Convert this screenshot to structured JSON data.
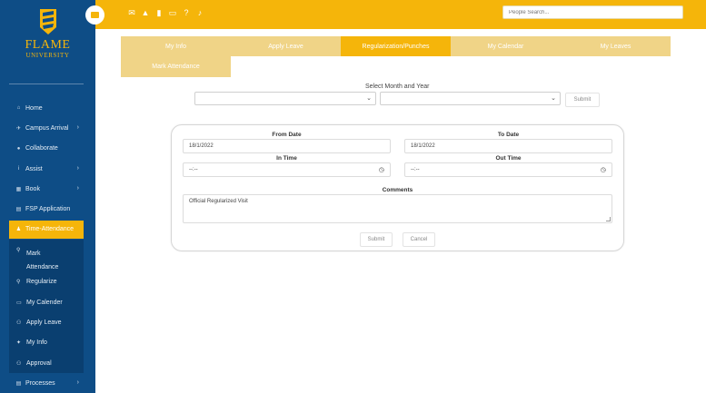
{
  "logo": {
    "line1": "FLAME",
    "line2": "UNIVERSITY"
  },
  "sidebar": {
    "items": [
      {
        "label": "Home",
        "icon": "home-icon",
        "glyph": "⌂",
        "arrow": ""
      },
      {
        "label": "Campus Arrival",
        "icon": "plane-icon",
        "glyph": "✈",
        "arrow": "›"
      },
      {
        "label": "Collaborate",
        "icon": "chat-icon",
        "glyph": "●",
        "arrow": ""
      },
      {
        "label": "Assist",
        "icon": "info-icon",
        "glyph": "i",
        "arrow": "›"
      },
      {
        "label": "Book",
        "icon": "calendar-icon",
        "glyph": "▦",
        "arrow": "›"
      },
      {
        "label": "FSP Application",
        "icon": "document-icon",
        "glyph": "▤",
        "arrow": ""
      },
      {
        "label": "Time-Attendance",
        "icon": "user-icon",
        "glyph": "♟",
        "arrow": ""
      }
    ],
    "submenu": [
      {
        "label": "Mark Attendance",
        "line1": "Mark",
        "line2": "Attendance",
        "icon": "search-icon",
        "glyph": "⚲"
      },
      {
        "label": "Regularize",
        "icon": "search-icon",
        "glyph": "⚲"
      },
      {
        "label": "My Calender",
        "icon": "keyboard-icon",
        "glyph": "▭"
      },
      {
        "label": "Apply Leave",
        "icon": "users-icon",
        "glyph": "⚇"
      },
      {
        "label": "My Info",
        "icon": "pin-icon",
        "glyph": "✦"
      },
      {
        "label": "Approval",
        "icon": "users-icon",
        "glyph": "⚇"
      }
    ],
    "processes": {
      "label": "Processes",
      "icon": "list-icon",
      "glyph": "▤",
      "arrow": "›"
    }
  },
  "topbar": {
    "icons": [
      {
        "name": "mail-icon",
        "glyph": "✉"
      },
      {
        "name": "graduation-cap-icon",
        "glyph": "▲"
      },
      {
        "name": "book-icon",
        "glyph": "▮"
      },
      {
        "name": "monitor-icon",
        "glyph": "▭"
      },
      {
        "name": "help-icon",
        "glyph": "?"
      },
      {
        "name": "bell-icon",
        "glyph": "♪"
      }
    ],
    "search_placeholder": "People Search..."
  },
  "tabs": {
    "row1": [
      "My Info",
      "Apply Leave",
      "Regularization/Punches",
      "My Calendar",
      "My Leaves"
    ],
    "row2": [
      "Mark Attendance"
    ],
    "active": "Regularization/Punches"
  },
  "select": {
    "label": "Select Month and Year",
    "month": "",
    "year": "",
    "submit": "Submit"
  },
  "form": {
    "from_date_label": "From Date",
    "from_date": "18/1/2022",
    "to_date_label": "To Date",
    "to_date": "18/1/2022",
    "in_time_label": "In Time",
    "in_time": "--:--",
    "out_time_label": "Out Time",
    "out_time": "--:--",
    "comments_label": "Comments",
    "comments": "Official Regularized Visit",
    "submit": "Submit",
    "cancel": "Cancel"
  },
  "colors": {
    "accent": "#f5b50a",
    "sidebar": "#0e4d86",
    "tab_inactive": "#f0d487"
  }
}
